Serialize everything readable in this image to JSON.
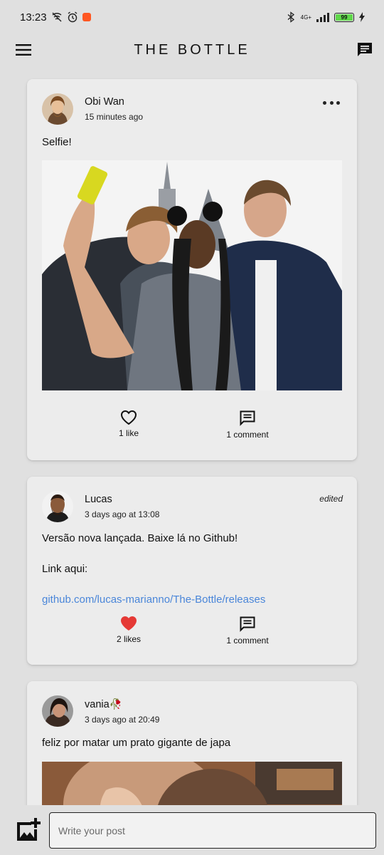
{
  "status_bar": {
    "time": "13:23",
    "battery_level": "99",
    "network": "4G+",
    "icons": [
      "wifi-off-icon",
      "alarm-icon",
      "reddit-notification-icon",
      "bluetooth-icon",
      "signal-icon",
      "battery-icon",
      "charging-icon"
    ]
  },
  "app_bar": {
    "title": "THE BOTTLE",
    "menu_icon": "menu-icon",
    "chat_icon": "chat-icon"
  },
  "posts": [
    {
      "author": "Obi Wan",
      "time": "15 minutes ago",
      "text": "Selfie!",
      "has_image": true,
      "liked": false,
      "likes_label": "1 like",
      "comments_label": "1 comment"
    },
    {
      "author": "Lucas",
      "time": "3 days ago at 13:08",
      "edited_label": "edited",
      "text_line_1": "Versão nova lançada. Baixe lá no Github!",
      "text_line_2": "Link aqui:",
      "link": "github.com/lucas-marianno/The-Bottle/releases",
      "liked": true,
      "likes_label": "2 likes",
      "comments_label": "1 comment"
    },
    {
      "author": "vania🥀",
      "time": "3 days ago at 20:49",
      "text": "feliz por matar um prato gigante de japa",
      "has_image": true
    }
  ],
  "composer": {
    "placeholder": "Write your post",
    "value": "",
    "add_photo_icon": "add-photo-icon"
  },
  "colors": {
    "background": "#e0e0e0",
    "card": "#ececec",
    "link": "#4a86d9",
    "liked_heart": "#e53935"
  }
}
